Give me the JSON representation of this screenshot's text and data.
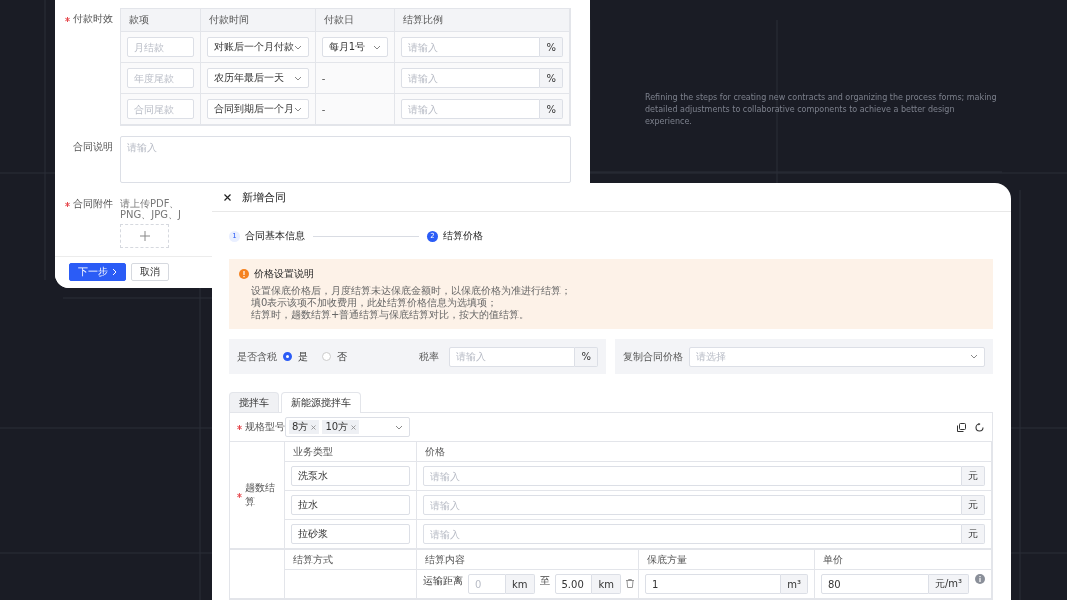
{
  "back_form": {
    "payment_terms": {
      "label": "付款时效",
      "required": true,
      "columns": [
        "款项",
        "付款时间",
        "付款日",
        "结算比例"
      ],
      "rows": [
        {
          "item_placeholder": "月结款",
          "time": "对账后一个月付款",
          "day": {
            "kind": "select",
            "value": "每月1号"
          },
          "ratio_placeholder": "请输入",
          "ratio_unit": "%"
        },
        {
          "item_placeholder": "年度尾款",
          "time": "农历年最后一天",
          "day": {
            "kind": "text",
            "value": "-"
          },
          "ratio_placeholder": "请输入",
          "ratio_unit": "%"
        },
        {
          "item_placeholder": "合同尾款",
          "time": "合同到期后一个月",
          "day": {
            "kind": "text",
            "value": "-"
          },
          "ratio_placeholder": "请输入",
          "ratio_unit": "%"
        }
      ]
    },
    "description": {
      "label": "合同说明",
      "placeholder": "请输入"
    },
    "attachment": {
      "label": "合同附件",
      "required": true,
      "hint": "请上传PDF、PNG、JPG、J"
    },
    "buttons": [
      {
        "label": "下一步",
        "kind": "primary"
      },
      {
        "label": "取消",
        "kind": "default"
      }
    ]
  },
  "caption": "Refining the steps for creating new contracts and organizing the process forms; making detailed adjustments to collaborative components to achieve a better design experience.",
  "dialog": {
    "title": "新增合同",
    "steps": [
      {
        "number": "1",
        "label": "合同基本信息",
        "selected": false
      },
      {
        "number": "2",
        "label": "结算价格",
        "selected": true
      }
    ],
    "notice": {
      "title": "价格设置说明",
      "lines": [
        "设置保底价格后，月度结算未达保底金额时，以保底价格为准进行结算；",
        "填0表示该项不加收费用，此处结算价格信息为选填项；",
        "结算时，趟数结算+普通结算与保底结算对比，按大的值结算。"
      ]
    },
    "tax": {
      "label": "是否含税",
      "options": [
        {
          "label": "是",
          "selected": true
        },
        {
          "label": "否",
          "selected": false
        }
      ]
    },
    "tax_rate": {
      "label": "税率",
      "placeholder": "请输入",
      "unit": "%"
    },
    "copy_price": {
      "label": "复制合同价格",
      "placeholder": "请选择"
    },
    "tabs": [
      {
        "label": "搅拌车",
        "selected": false
      },
      {
        "label": "新能源搅拌车",
        "selected": true
      }
    ],
    "spec": {
      "label": "规格型号",
      "required": true,
      "tags": [
        "8方",
        "10方"
      ]
    },
    "trip_settlement": {
      "label": "趟数结算",
      "required": true,
      "columns": [
        "业务类型",
        "价格"
      ],
      "rows": [
        {
          "type": "洗泵水",
          "price_placeholder": "请输入",
          "unit": "元"
        },
        {
          "type": "拉水",
          "price_placeholder": "请输入",
          "unit": "元"
        },
        {
          "type": "拉砂浆",
          "price_placeholder": "请输入",
          "unit": "元"
        }
      ]
    },
    "normal_settlement": {
      "columns": [
        "结算方式",
        "结算内容",
        "保底方量",
        "单价"
      ],
      "rows": [
        {
          "content_label": "运输距离",
          "from_placeholder": "0",
          "from_unit": "km",
          "to_word": "至",
          "to_value": "5.00",
          "to_unit": "km",
          "min_volume": "1",
          "volume_unit": "m³",
          "price": "80",
          "price_unit": "元/m³"
        }
      ]
    }
  }
}
